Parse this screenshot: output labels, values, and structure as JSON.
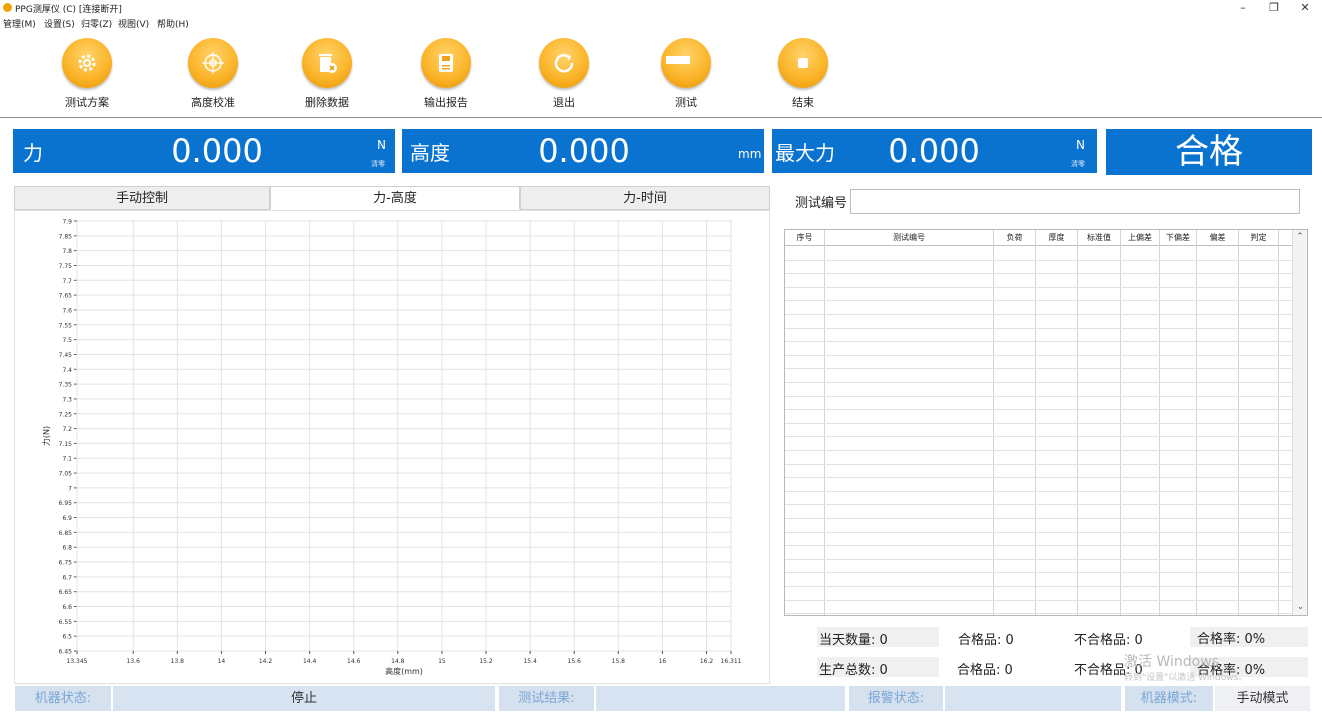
{
  "window": {
    "title": "PPG测厚仪 (C)  [连接断开]",
    "controls": {
      "minimize": "–",
      "restore": "❐",
      "close": "✕"
    }
  },
  "menu": [
    "管理(M)",
    "设置(S)",
    "归零(Z)",
    "视图(V)",
    "帮助(H)"
  ],
  "toolbar": [
    {
      "label": "测试方案",
      "icon": "gear-icon"
    },
    {
      "label": "高度校准",
      "icon": "crosshair-icon"
    },
    {
      "label": "删除数据",
      "icon": "trash-delete-icon"
    },
    {
      "label": "输出报告",
      "icon": "save-report-icon"
    },
    {
      "label": "退出",
      "icon": "exit-refresh-icon"
    },
    {
      "label": "测试",
      "icon": "ruler-icon"
    },
    {
      "label": "结束",
      "icon": "stop-icon"
    }
  ],
  "readouts": {
    "force": {
      "label": "力",
      "value": "0.000",
      "unit": "N",
      "zero": "清零"
    },
    "height": {
      "label": "高度",
      "value": "0.000",
      "unit": "mm"
    },
    "max_force": {
      "label": "最大力",
      "value": "0.000",
      "unit": "N",
      "zero": "清零"
    },
    "result": "合格"
  },
  "tabs": [
    "手动控制",
    "力-高度",
    "力-时间"
  ],
  "chart_data": {
    "type": "line",
    "xlabel": "高度(mm)",
    "ylabel": "力(N)",
    "xlim": [
      13.345,
      16.311
    ],
    "ylim": [
      6.45,
      7.9
    ],
    "xticks": [
      "13.345",
      "13.6",
      "13.8",
      "14",
      "14.2",
      "14.4",
      "14.6",
      "14.8",
      "15",
      "15.2",
      "15.4",
      "15.6",
      "15.8",
      "16",
      "16.2",
      "16.311"
    ],
    "xtick_values": [
      13.345,
      13.6,
      13.8,
      14,
      14.2,
      14.4,
      14.6,
      14.8,
      15,
      15.2,
      15.4,
      15.6,
      15.8,
      16,
      16.2,
      16.311
    ],
    "yticks": [
      "6.45",
      "6.5",
      "6.55",
      "6.6",
      "6.65",
      "6.7",
      "6.75",
      "6.8",
      "6.85",
      "6.9",
      "6.95",
      "7",
      "7.05",
      "7.1",
      "7.15",
      "7.2",
      "7.25",
      "7.3",
      "7.35",
      "7.4",
      "7.45",
      "7.5",
      "7.55",
      "7.6",
      "7.65",
      "7.7",
      "7.75",
      "7.8",
      "7.85",
      "7.9"
    ],
    "series": [],
    "grid": true
  },
  "serial": {
    "label": "测试编号",
    "value": ""
  },
  "table": {
    "columns": [
      "序号",
      "测试编号",
      "负荷",
      "厚度",
      "标准值",
      "上偏差",
      "下偏差",
      "偏差",
      "判定"
    ],
    "rows": []
  },
  "stats": {
    "today_count": "当天数量: 0",
    "today_pass": "合格品: 0",
    "today_fail": "不合格品: 0",
    "today_rate": "合格率:  0%",
    "total_count": "生产总数: 0",
    "total_pass": "合格品: 0",
    "total_fail": "不合格品: 0",
    "total_rate": "合格率:  0%"
  },
  "statusbar": {
    "machine_state_label": "机器状态:",
    "machine_state": "停止",
    "test_result_label": "测试结果:",
    "test_result": "",
    "alarm_label": "报警状态:",
    "alarm": "",
    "mode_label": "机器模式:",
    "mode": "手动模式"
  },
  "watermark": {
    "line1": "激活 Windows",
    "line2": "转到\"设置\"以激活 Windows。"
  },
  "colors": {
    "accent": "#0a73cf",
    "orange": "#fbb52a"
  }
}
